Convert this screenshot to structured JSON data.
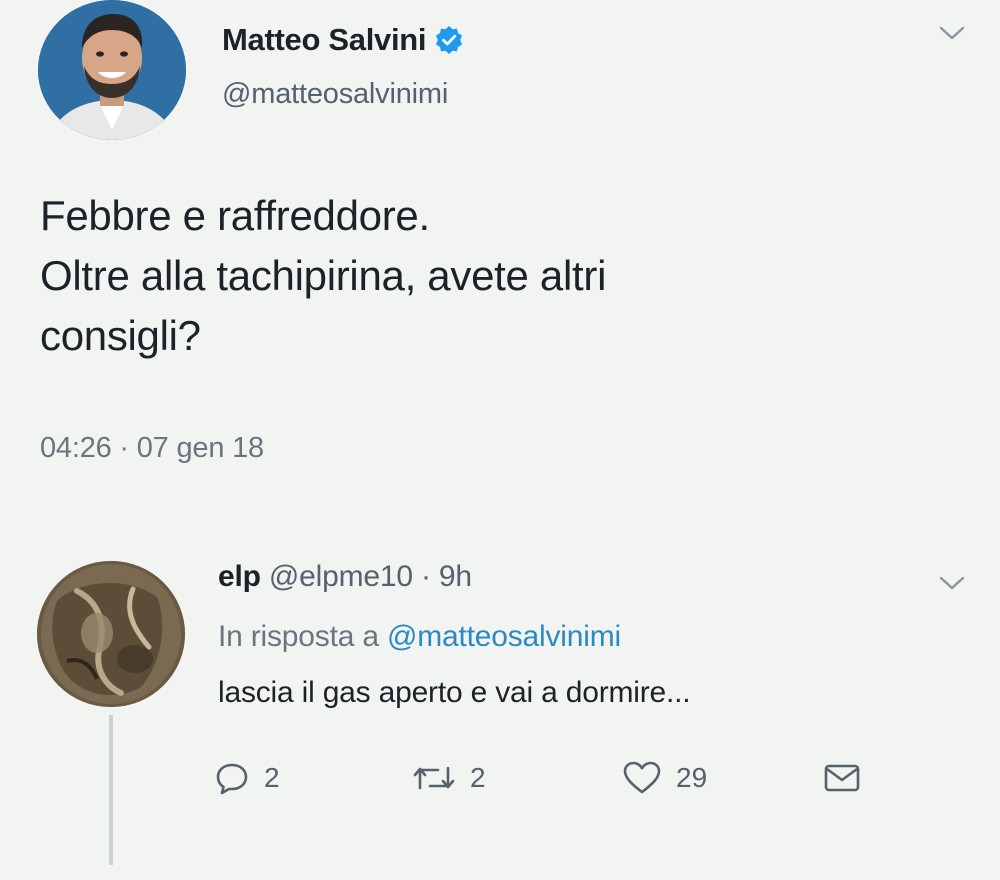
{
  "main_tweet": {
    "author": {
      "display_name": "Matteo Salvini",
      "handle": "@matteosalvinimi",
      "verified": true
    },
    "text_lines": [
      "Febbre e raffreddore.",
      "Oltre alla tachipirina, avete altri",
      "consigli?"
    ],
    "timestamp": "04:26 · 07 gen 18"
  },
  "reply": {
    "author": {
      "display_name": "elp",
      "handle": "@elpme10",
      "age": "9h"
    },
    "meta_separator": " · ",
    "in_reply_to_label": "In risposta a",
    "in_reply_to_handle": "@matteosalvinimi",
    "text": "lascia il gas aperto e vai a dormire...",
    "actions": {
      "replies": "2",
      "retweets": "2",
      "likes": "29"
    }
  },
  "colors": {
    "background": "#f2f4f2",
    "text": "#1c2228",
    "secondary_text": "#55626d",
    "link": "#2b8ac3",
    "verified_badge": "#1d9bf0"
  },
  "icons": {
    "verified": "verified-badge-icon",
    "menu": "chevron-down-icon",
    "reply": "speech-bubble-icon",
    "retweet": "retweet-icon",
    "like": "heart-icon",
    "direct_message": "envelope-icon"
  }
}
